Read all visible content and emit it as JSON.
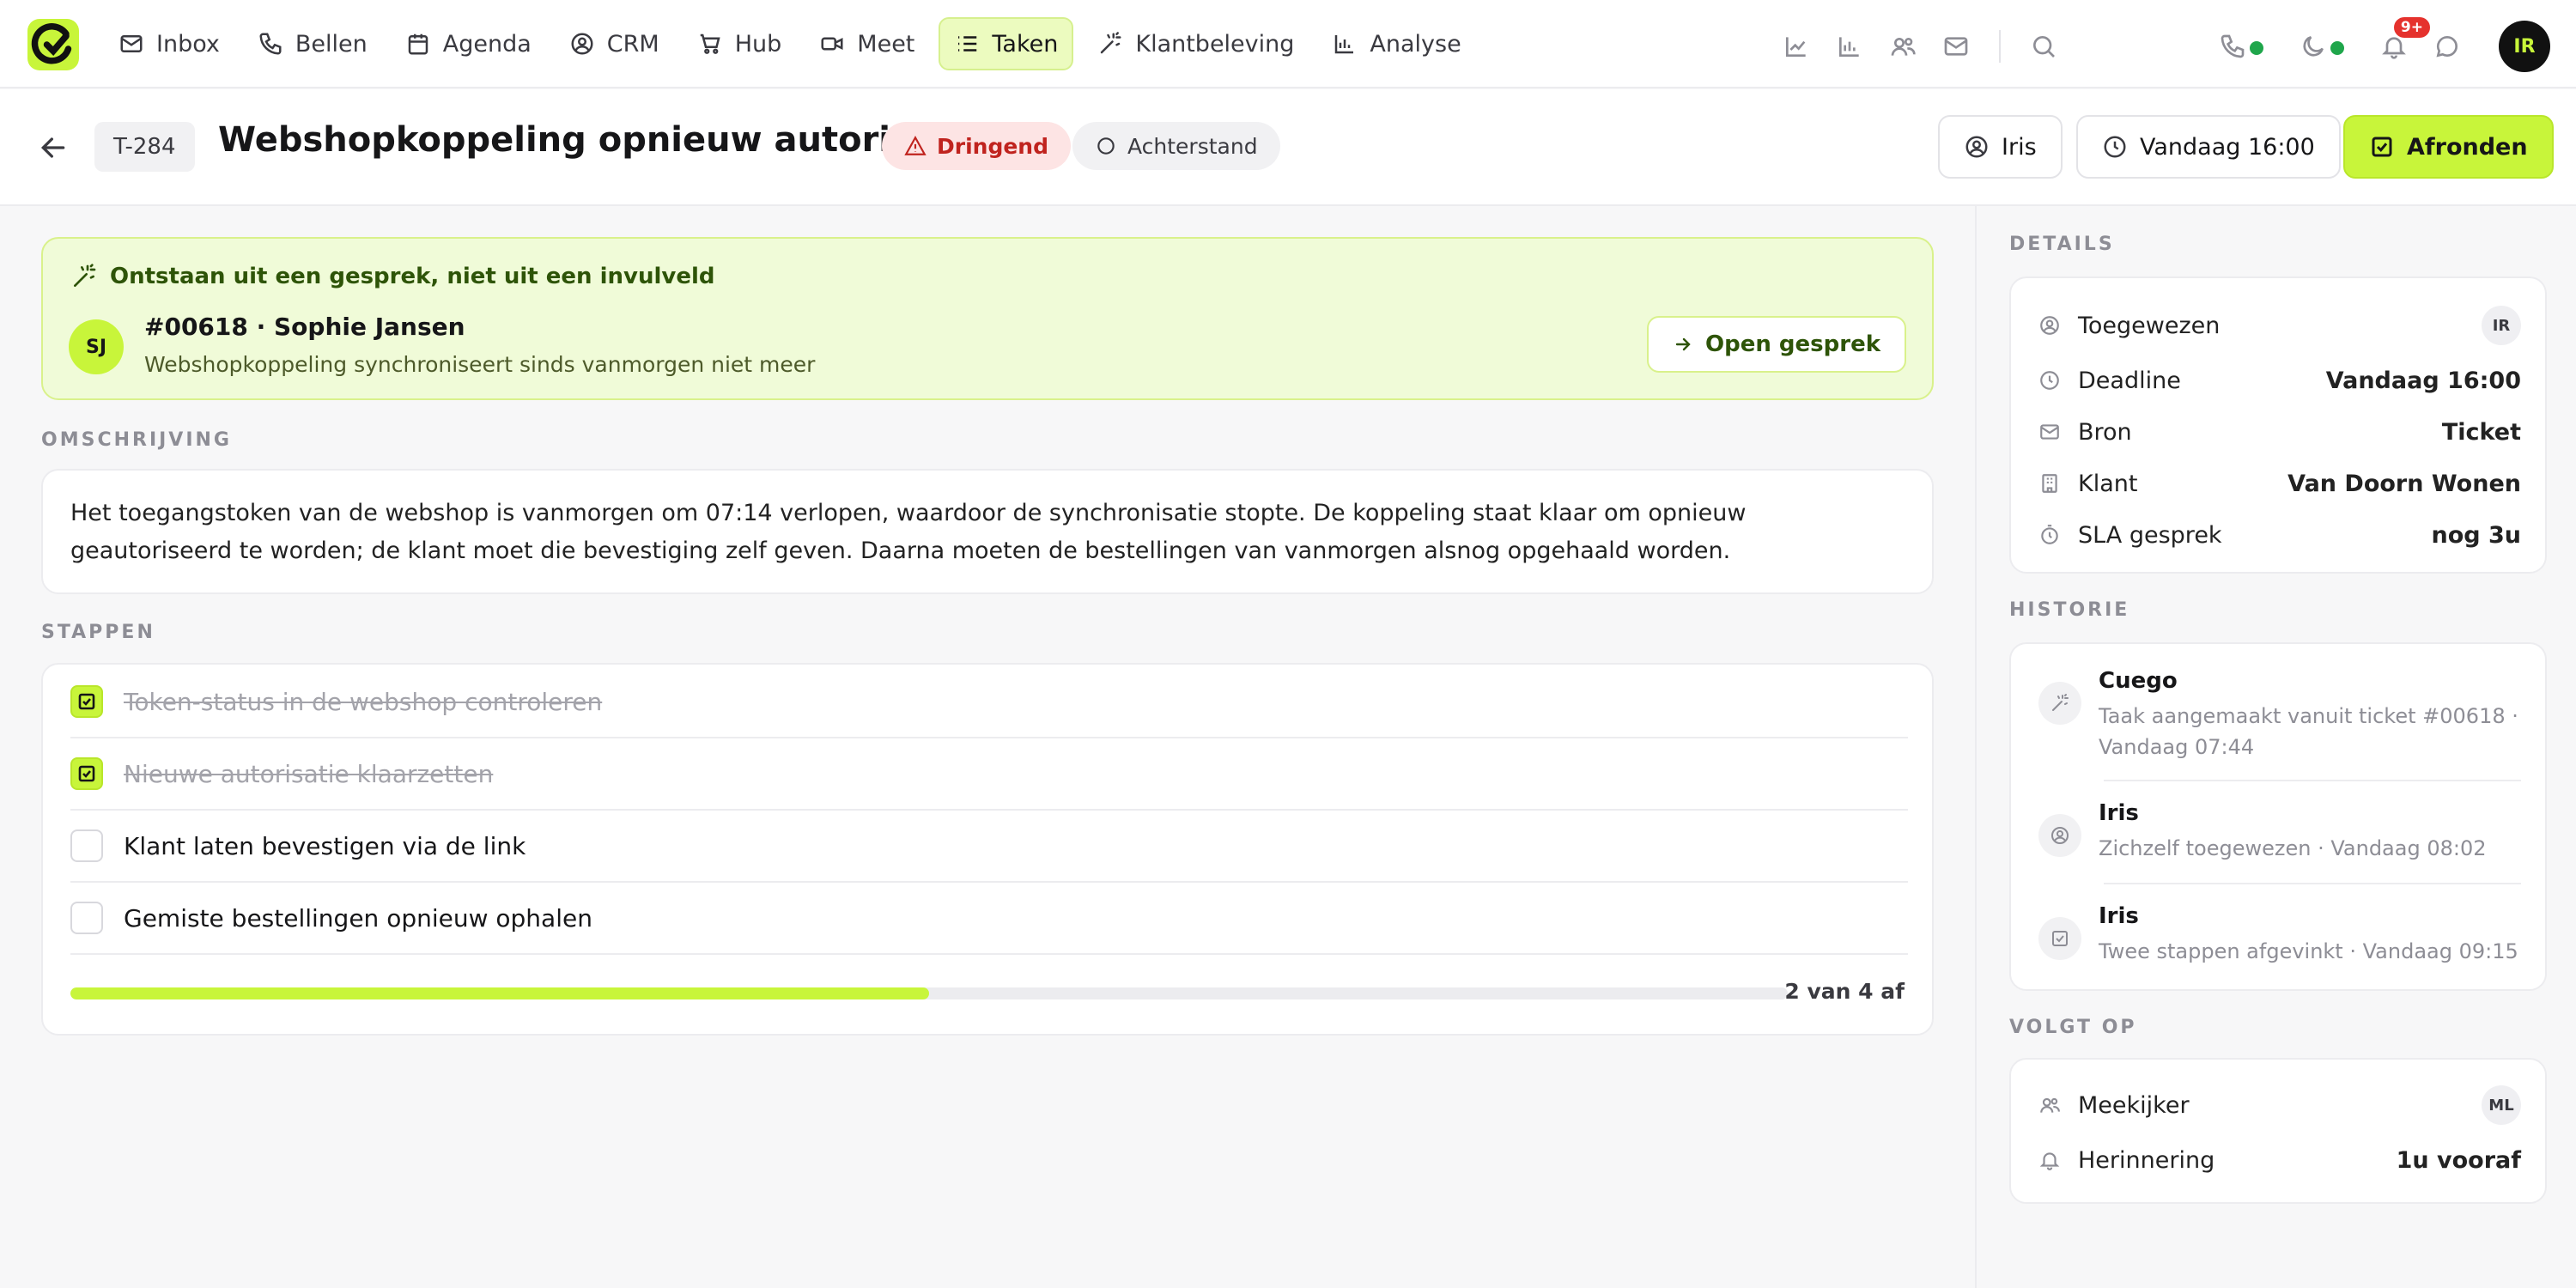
{
  "nav": {
    "items": [
      {
        "label": "Inbox",
        "icon": "mail-icon"
      },
      {
        "label": "Bellen",
        "icon": "phone-icon"
      },
      {
        "label": "Agenda",
        "icon": "calendar-icon"
      },
      {
        "label": "CRM",
        "icon": "user-circle-icon"
      },
      {
        "label": "Hub",
        "icon": "cart-icon"
      },
      {
        "label": "Meet",
        "icon": "video-icon"
      },
      {
        "label": "Taken",
        "icon": "list-icon",
        "active": true
      },
      {
        "label": "Klantbeleving",
        "icon": "sparkle-icon"
      },
      {
        "label": "Analyse",
        "icon": "bar-chart-icon"
      }
    ],
    "notification_badge": "9+",
    "user_initials": "IR"
  },
  "header": {
    "ticket_id": "T-284",
    "title": "Webshopkoppeling opnieuw autoriseren",
    "priority": "Dringend",
    "status": "Achterstand",
    "assignee_button": "Iris",
    "deadline_button": "Vandaag 16:00",
    "primary_button": "Afronden"
  },
  "origin": {
    "title": "Ontstaan uit een gesprek, niet uit een invulveld",
    "avatar": "SJ",
    "name": "#00618 · Sophie Jansen",
    "subtitle": "Webshopkoppeling synchroniseert sinds vanmorgen niet meer",
    "open_button": "Open gesprek"
  },
  "description": {
    "label": "OMSCHRIJVING",
    "text": "Het toegangstoken van de webshop is vanmorgen om 07:14 verlopen, waardoor de synchronisatie stopte. De koppeling staat klaar om opnieuw geautoriseerd te worden; de klant moet die bevestiging zelf geven. Daarna moeten de bestellingen van vanmorgen alsnog opgehaald worden."
  },
  "steps": {
    "label": "STAPPEN",
    "items": [
      {
        "label": "Token-status in de webshop controleren",
        "done": true
      },
      {
        "label": "Nieuwe autorisatie klaarzetten",
        "done": true
      },
      {
        "label": "Klant laten bevestigen via de link",
        "done": false
      },
      {
        "label": "Gemiste bestellingen opnieuw ophalen",
        "done": false
      }
    ],
    "progress": 0.5,
    "progress_text": "2 van 4 af"
  },
  "details": {
    "label": "DETAILS",
    "assigned_label": "Toegewezen",
    "assigned_initials": "IR",
    "deadline_label": "Deadline",
    "deadline_value": "Vandaag 16:00",
    "source_label": "Bron",
    "source_value": "Ticket",
    "client_label": "Klant",
    "client_value": "Van Doorn Wonen",
    "sla_label": "SLA gesprek",
    "sla_value": "nog 3u"
  },
  "history": {
    "label": "HISTORIE",
    "items": [
      {
        "name": "Cuego",
        "sub": "Taak aangemaakt vanuit ticket #00618 · Vandaag 07:44",
        "icon": "sparkle-icon"
      },
      {
        "name": "Iris",
        "sub": "Zichzelf toegewezen · Vandaag 08:02",
        "icon": "user-circle-icon"
      },
      {
        "name": "Iris",
        "sub": "Twee stappen afgevinkt · Vandaag 09:15",
        "icon": "check-square-icon"
      }
    ]
  },
  "follow": {
    "label": "VOLGT OP",
    "watcher_label": "Meekijker",
    "watcher_initials": "ML",
    "reminder_label": "Herinnering",
    "reminder_value": "1u vooraf"
  },
  "colors": {
    "accent": "#c8f53a",
    "urgent": "#c0231e",
    "online": "#1fa64b"
  }
}
